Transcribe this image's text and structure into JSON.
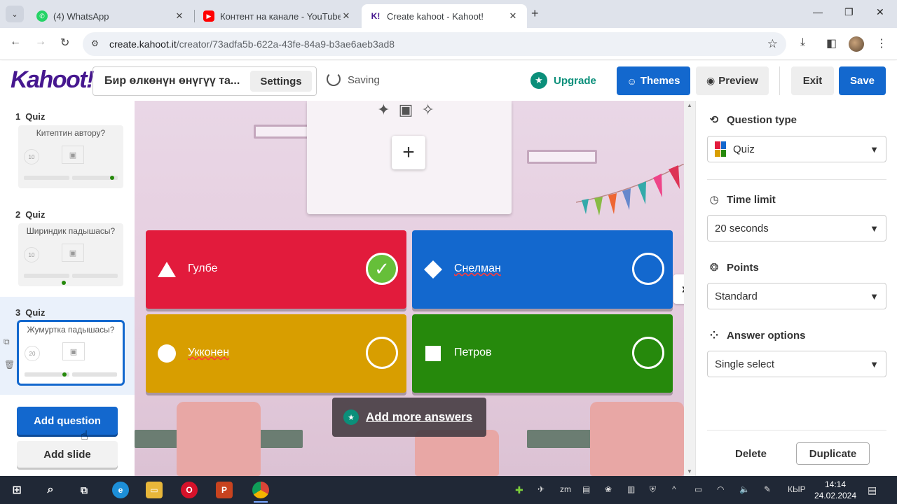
{
  "browser": {
    "tabs": [
      {
        "title": "(4) WhatsApp",
        "favicon": "whatsapp-icon",
        "color": "#25d366"
      },
      {
        "title": "Контент на канале - YouTube S",
        "favicon": "youtube-icon",
        "color": "#ff0000"
      },
      {
        "title": "Create kahoot - Kahoot!",
        "favicon": "kahoot-icon",
        "color": "#46178f"
      }
    ],
    "url_host": "create.kahoot.it",
    "url_path": "/creator/73adfa5b-622a-43fe-84a9-b3ae6aeb3ad8"
  },
  "header": {
    "logo": "Kahoot!",
    "kahoot_title": "Бир өлкөнүн өнүгүү та...",
    "settings": "Settings",
    "status": "Saving",
    "upgrade": "Upgrade",
    "themes": "Themes",
    "preview": "Preview",
    "exit": "Exit",
    "save": "Save",
    "accent": "#1368ce",
    "brand": "#46178f"
  },
  "slides": [
    {
      "num": "1",
      "type": "Quiz",
      "question": "Китептин автору?",
      "time": "10"
    },
    {
      "num": "2",
      "type": "Quiz",
      "question": "Шириндик падышасы?",
      "time": "10"
    },
    {
      "num": "3",
      "type": "Quiz",
      "question": "Жумуртка падышасы?",
      "time": "20"
    }
  ],
  "left_actions": {
    "add_question": "Add question",
    "add_slide": "Add slide"
  },
  "answers": [
    {
      "text": "Гулбе",
      "shape": "triangle-icon",
      "color": "#e21b3c",
      "correct": true
    },
    {
      "text": "Снелман",
      "shape": "diamond-icon",
      "color": "#1368ce",
      "correct": false
    },
    {
      "text": "Укконен",
      "shape": "circle-icon",
      "color": "#d89e00",
      "correct": false
    },
    {
      "text": "Петров",
      "shape": "square-icon",
      "color": "#26890c",
      "correct": false
    }
  ],
  "add_more_answers": "Add more answers",
  "settings_panel": {
    "question_type_label": "Question type",
    "question_type": "Quiz",
    "time_limit_label": "Time limit",
    "time_limit": "20 seconds",
    "points_label": "Points",
    "points": "Standard",
    "answer_options_label": "Answer options",
    "answer_options": "Single select",
    "delete": "Delete",
    "duplicate": "Duplicate"
  },
  "taskbar": {
    "lang": "КЫР",
    "time": "14:14",
    "date": "24.02.2024"
  }
}
